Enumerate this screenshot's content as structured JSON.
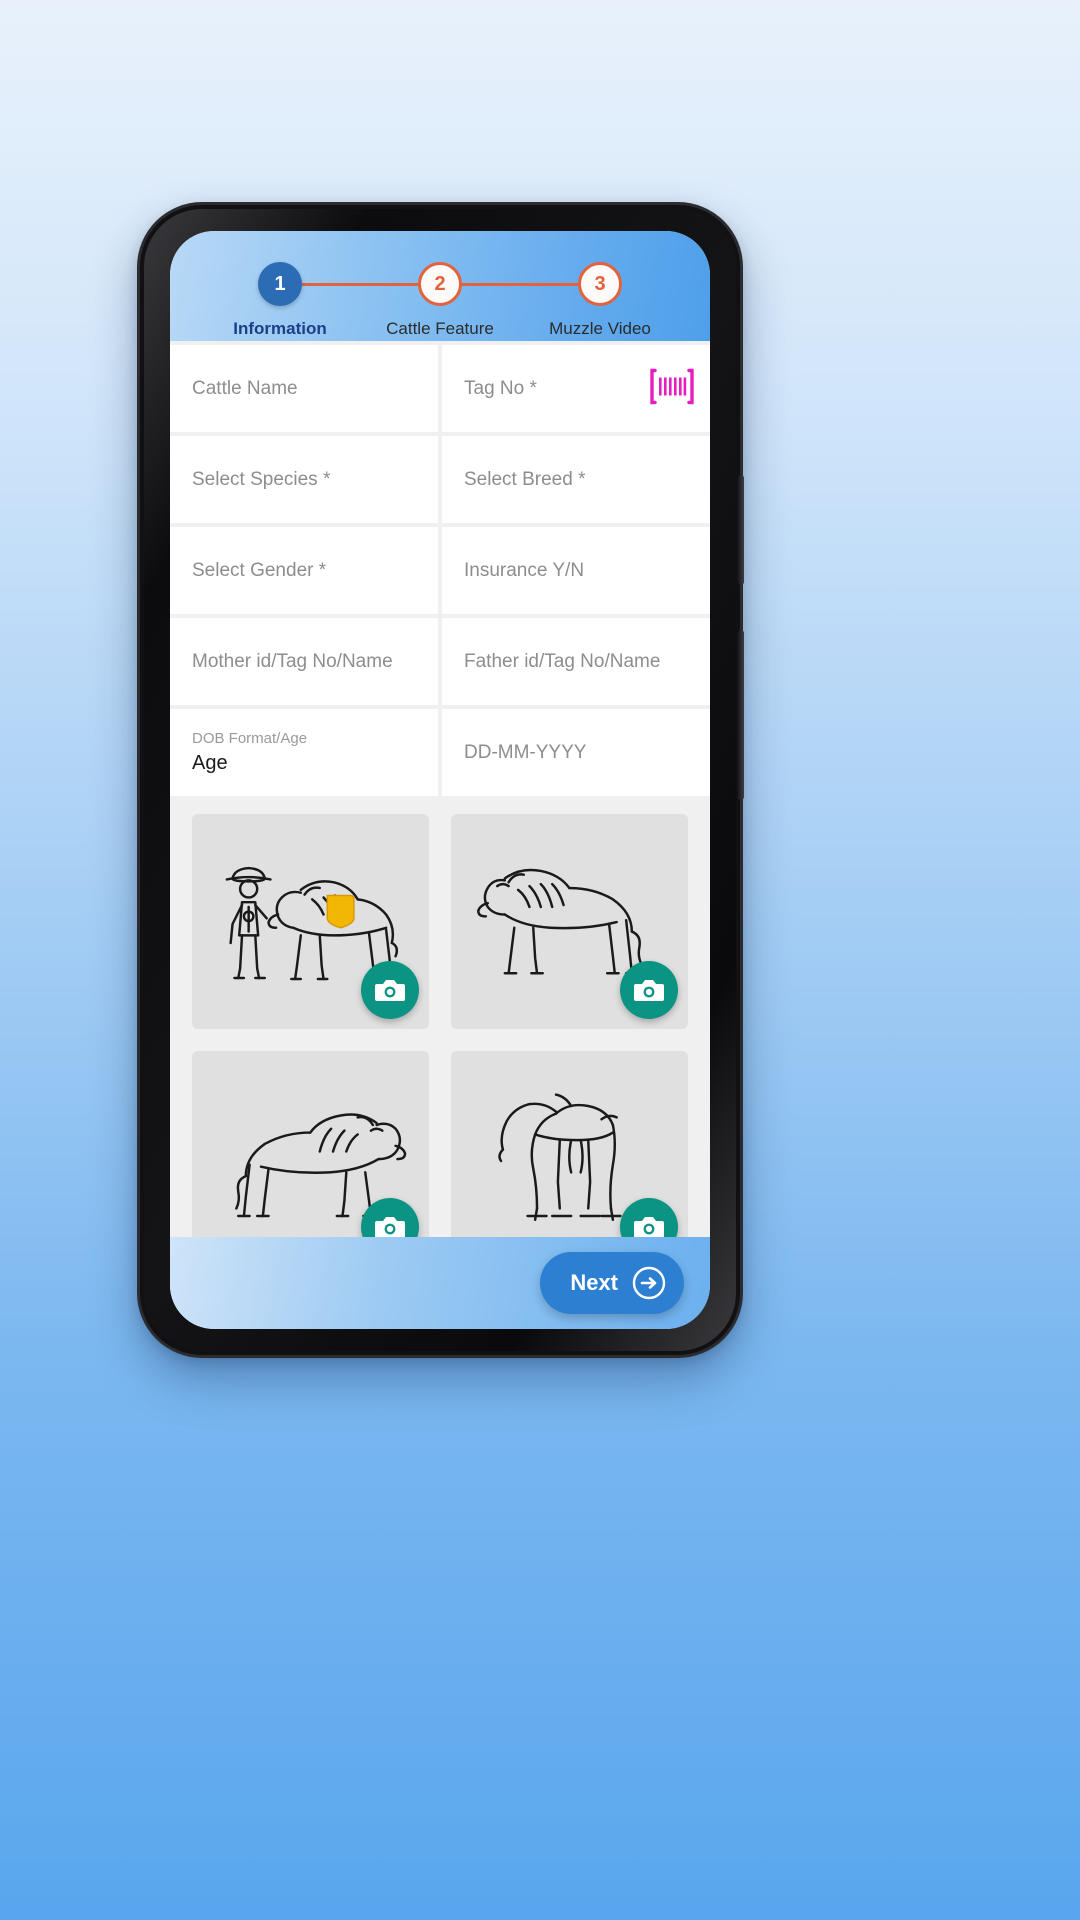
{
  "stepper": {
    "steps": [
      {
        "number": "1",
        "label": "Information",
        "state": "active"
      },
      {
        "number": "2",
        "label": "Cattle Feature",
        "state": "pending"
      },
      {
        "number": "3",
        "label": "Muzzle Video",
        "state": "pending"
      }
    ],
    "active_color": "#2b6cb5",
    "pending_color": "#e2623c",
    "active_label_color": "#1c3f86"
  },
  "form": {
    "fields": [
      {
        "name": "cattle-name",
        "placeholder": "Cattle Name",
        "value": "",
        "icon": ""
      },
      {
        "name": "tag-no",
        "placeholder": "Tag No *",
        "value": "",
        "icon": "barcode-icon"
      },
      {
        "name": "select-species",
        "placeholder": "Select Species *",
        "value": "",
        "icon": ""
      },
      {
        "name": "select-breed",
        "placeholder": "Select Breed *",
        "value": "",
        "icon": ""
      },
      {
        "name": "select-gender",
        "placeholder": "Select Gender *",
        "value": "",
        "icon": ""
      },
      {
        "name": "insurance",
        "placeholder": "Insurance Y/N",
        "value": "",
        "icon": ""
      },
      {
        "name": "mother-id",
        "placeholder": "Mother id/Tag No/Name",
        "value": "",
        "icon": ""
      },
      {
        "name": "father-id",
        "placeholder": "Father id/Tag No/Name",
        "value": "",
        "icon": ""
      }
    ],
    "dob_format": {
      "label": "DOB Format/Age",
      "value": "Age"
    },
    "dob_date": {
      "placeholder": "DD-MM-YYYY",
      "value": ""
    },
    "barcode_color": "#e61ec0"
  },
  "photos": {
    "tiles": [
      {
        "name": "photo-tile-farmer-with-cattle",
        "art": "farmer-cattle",
        "camera_label": "camera-icon"
      },
      {
        "name": "photo-tile-cattle-side",
        "art": "cattle-side",
        "camera_label": "camera-icon"
      },
      {
        "name": "photo-tile-cattle-front",
        "art": "cattle-front",
        "camera_label": "camera-icon"
      },
      {
        "name": "photo-tile-cattle-rear",
        "art": "cattle-rear",
        "camera_label": "camera-icon"
      }
    ],
    "fab_color": "#0b9384"
  },
  "bottom": {
    "next_label": "Next",
    "next_icon": "arrow-right-circle-icon",
    "next_color": "#2d7fd2"
  }
}
